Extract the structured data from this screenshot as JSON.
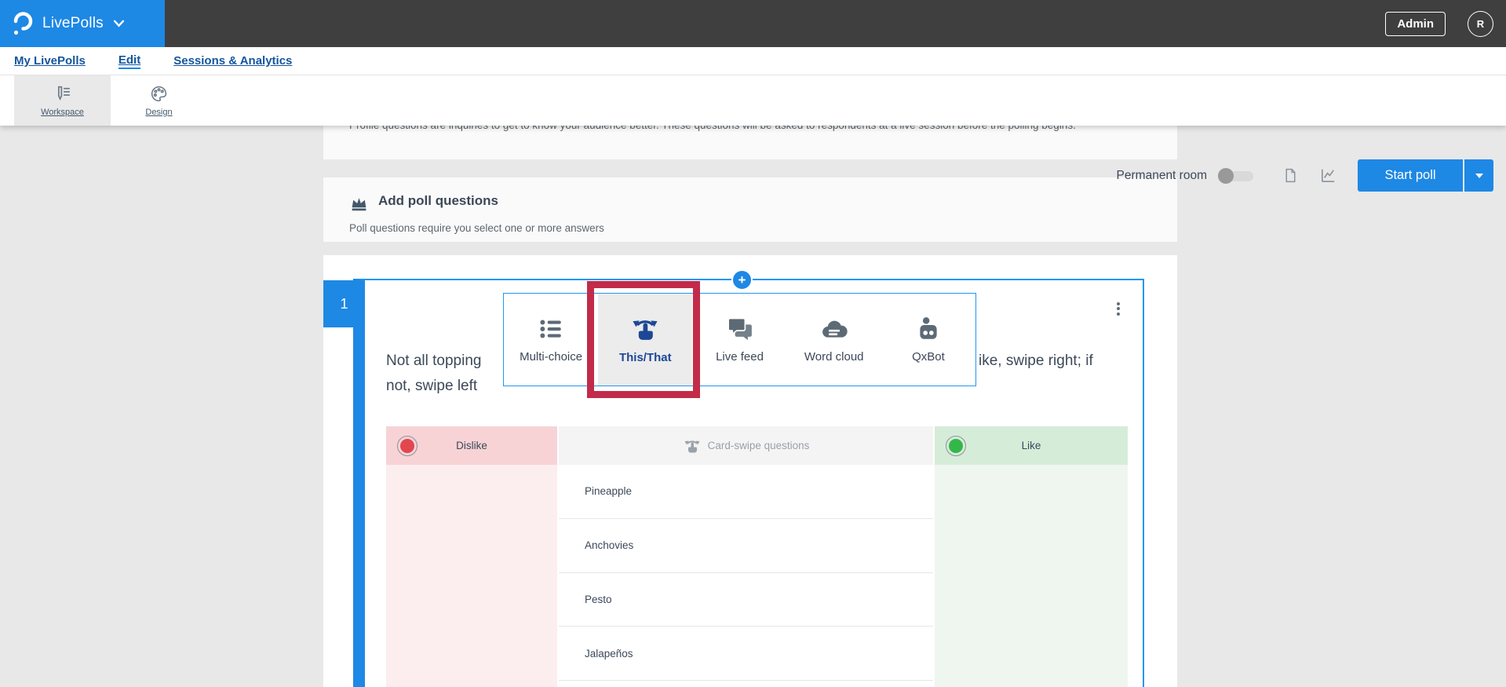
{
  "header": {
    "app_name": "LivePolls",
    "admin_label": "Admin",
    "avatar_initial": "R"
  },
  "nav": {
    "items": [
      {
        "label": "My LivePolls",
        "active": false
      },
      {
        "label": "Edit",
        "active": true
      },
      {
        "label": "Sessions & Analytics",
        "active": false
      }
    ]
  },
  "toolbar": {
    "tabs": [
      {
        "label": "Workspace",
        "selected": true
      },
      {
        "label": "Design",
        "selected": false
      }
    ],
    "permanent_room_label": "Permanent room",
    "permanent_room_on": false,
    "start_poll_label": "Start poll"
  },
  "profile_section": {
    "description": "Profile questions are inquiries to get to know your audience better. These questions will be asked to respondents at a live session before the polling begins."
  },
  "poll_section": {
    "title": "Add poll questions",
    "subtitle": "Poll questions require you select one or more answers"
  },
  "question": {
    "number": "1",
    "visible_text_line1_left": "Not all topping",
    "visible_text_line1_right": "ike, swipe right; if",
    "visible_text_line2": "not, swipe left",
    "plus_glyph": "+",
    "type_options": [
      {
        "label": "Multi-choice",
        "selected": false
      },
      {
        "label": "This/That",
        "selected": true
      },
      {
        "label": "Live feed",
        "selected": false
      },
      {
        "label": "Word cloud",
        "selected": false
      },
      {
        "label": "QxBot",
        "selected": false
      }
    ],
    "table": {
      "left_header": "Dislike",
      "center_placeholder": "Card-swipe questions",
      "right_header": "Like",
      "rows": [
        "Pineapple",
        "Anchovies",
        "Pesto",
        "Jalapeños"
      ]
    }
  },
  "colors": {
    "primary_blue": "#1e88e5",
    "card_border_blue": "#2196f3",
    "header_dark": "#3f3f3f",
    "nav_link_blue": "#14569d",
    "selected_type_navy": "#1d4796",
    "annotation_red": "#c22b49",
    "dislike_red": "#e2474f",
    "like_green": "#34b74a",
    "dislike_header_bg": "#f7d3d6",
    "dislike_body_bg": "#fcedef",
    "like_header_bg": "#d5ecd9",
    "like_body_bg": "#eff6ef"
  }
}
